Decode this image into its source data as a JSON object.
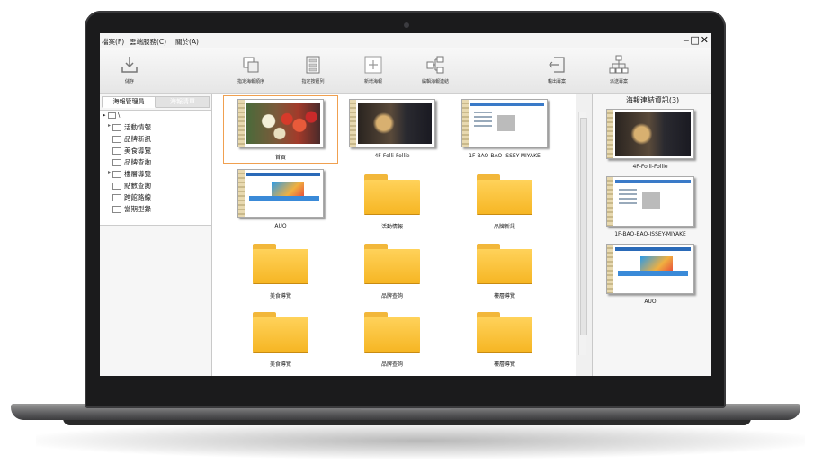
{
  "menu": {
    "items": [
      "檔案(F)",
      "雲端服務(C)",
      "關於(A)"
    ],
    "window_controls": "‒□✕"
  },
  "toolbar": {
    "buttons": [
      {
        "label": "儲存",
        "icon": "download-save-icon"
      },
      {
        "label": "指定海報順序",
        "icon": "layers-icon"
      },
      {
        "label": "指定按鈕列",
        "icon": "list-panel-icon"
      },
      {
        "label": "新增海報",
        "icon": "add-box-icon"
      },
      {
        "label": "編輯海報連結",
        "icon": "link-nodes-icon"
      },
      {
        "label": "輸出專案",
        "icon": "export-icon"
      },
      {
        "label": "派送專案",
        "icon": "network-tree-icon"
      }
    ]
  },
  "left_panel": {
    "tabs": [
      "海報管理員",
      "海報清單"
    ],
    "active_tab": 0,
    "tree_root": "\\",
    "tree_items": [
      {
        "label": "活動情報",
        "expandable": true
      },
      {
        "label": "品牌新訊",
        "expandable": false
      },
      {
        "label": "美食導覽",
        "expandable": false
      },
      {
        "label": "品牌查詢",
        "expandable": false
      },
      {
        "label": "樓層導覽",
        "expandable": true
      },
      {
        "label": "點數查詢",
        "expandable": false
      },
      {
        "label": "跨館路線",
        "expandable": false
      },
      {
        "label": "當期型錄",
        "expandable": false
      }
    ]
  },
  "content": {
    "items": [
      {
        "label": "首頁",
        "kind": "poster",
        "thumb": "flowers"
      },
      {
        "label": "4F-Folli-Follie",
        "kind": "poster",
        "thumb": "shop"
      },
      {
        "label": "1F-BAO-BAO-ISSEY-MIYAKE",
        "kind": "poster",
        "thumb": "web"
      },
      {
        "label": "AUO",
        "kind": "poster",
        "thumb": "blue"
      },
      {
        "label": "活動情報",
        "kind": "folder"
      },
      {
        "label": "品牌新訊",
        "kind": "folder"
      },
      {
        "label": "美食導覽",
        "kind": "folder"
      },
      {
        "label": "品牌查詢",
        "kind": "folder"
      },
      {
        "label": "樓層導覽",
        "kind": "folder"
      },
      {
        "label": "美食導覽",
        "kind": "folder"
      },
      {
        "label": "品牌查詢",
        "kind": "folder"
      },
      {
        "label": "樓層導覽",
        "kind": "folder"
      }
    ],
    "selected_index": 0
  },
  "right_panel": {
    "title": "海報連結資訊(3)",
    "items": [
      {
        "label": "4F-Folli-Follie",
        "thumb": "shop"
      },
      {
        "label": "1F-BAO-BAO-ISSEY-MIYAKE",
        "thumb": "web"
      },
      {
        "label": "AUO",
        "thumb": "blue"
      }
    ]
  },
  "colors": {
    "folder": "#f6b624",
    "selection": "#f0a050",
    "bezel": "#1b1b1c"
  }
}
